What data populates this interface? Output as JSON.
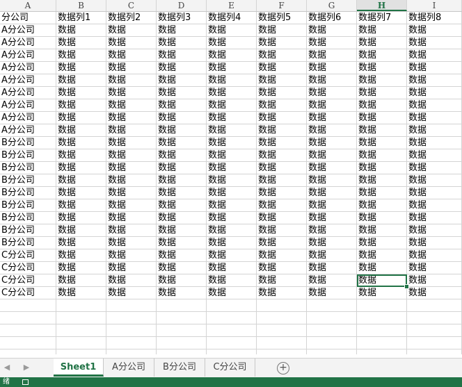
{
  "columns": [
    "A",
    "B",
    "C",
    "D",
    "E",
    "F",
    "G",
    "H",
    "I"
  ],
  "active_column": "H",
  "header_row": [
    "分公司",
    "数据列1",
    "数据列2",
    "数据列3",
    "数据列4",
    "数据列5",
    "数据列6",
    "数据列7",
    "数据列8"
  ],
  "rows": [
    [
      "A分公司",
      "数据",
      "数据",
      "数据",
      "数据",
      "数据",
      "数据",
      "数据",
      "数据"
    ],
    [
      "A分公司",
      "数据",
      "数据",
      "数据",
      "数据",
      "数据",
      "数据",
      "数据",
      "数据"
    ],
    [
      "A分公司",
      "数据",
      "数据",
      "数据",
      "数据",
      "数据",
      "数据",
      "数据",
      "数据"
    ],
    [
      "A分公司",
      "数据",
      "数据",
      "数据",
      "数据",
      "数据",
      "数据",
      "数据",
      "数据"
    ],
    [
      "A分公司",
      "数据",
      "数据",
      "数据",
      "数据",
      "数据",
      "数据",
      "数据",
      "数据"
    ],
    [
      "A分公司",
      "数据",
      "数据",
      "数据",
      "数据",
      "数据",
      "数据",
      "数据",
      "数据"
    ],
    [
      "A分公司",
      "数据",
      "数据",
      "数据",
      "数据",
      "数据",
      "数据",
      "数据",
      "数据"
    ],
    [
      "A分公司",
      "数据",
      "数据",
      "数据",
      "数据",
      "数据",
      "数据",
      "数据",
      "数据"
    ],
    [
      "A分公司",
      "数据",
      "数据",
      "数据",
      "数据",
      "数据",
      "数据",
      "数据",
      "数据"
    ],
    [
      "B分公司",
      "数据",
      "数据",
      "数据",
      "数据",
      "数据",
      "数据",
      "数据",
      "数据"
    ],
    [
      "B分公司",
      "数据",
      "数据",
      "数据",
      "数据",
      "数据",
      "数据",
      "数据",
      "数据"
    ],
    [
      "B分公司",
      "数据",
      "数据",
      "数据",
      "数据",
      "数据",
      "数据",
      "数据",
      "数据"
    ],
    [
      "B分公司",
      "数据",
      "数据",
      "数据",
      "数据",
      "数据",
      "数据",
      "数据",
      "数据"
    ],
    [
      "B分公司",
      "数据",
      "数据",
      "数据",
      "数据",
      "数据",
      "数据",
      "数据",
      "数据"
    ],
    [
      "B分公司",
      "数据",
      "数据",
      "数据",
      "数据",
      "数据",
      "数据",
      "数据",
      "数据"
    ],
    [
      "B分公司",
      "数据",
      "数据",
      "数据",
      "数据",
      "数据",
      "数据",
      "数据",
      "数据"
    ],
    [
      "B分公司",
      "数据",
      "数据",
      "数据",
      "数据",
      "数据",
      "数据",
      "数据",
      "数据"
    ],
    [
      "B分公司",
      "数据",
      "数据",
      "数据",
      "数据",
      "数据",
      "数据",
      "数据",
      "数据"
    ],
    [
      "C分公司",
      "数据",
      "数据",
      "数据",
      "数据",
      "数据",
      "数据",
      "数据",
      "数据"
    ],
    [
      "C分公司",
      "数据",
      "数据",
      "数据",
      "数据",
      "数据",
      "数据",
      "数据",
      "数据"
    ],
    [
      "C分公司",
      "数据",
      "数据",
      "数据",
      "数据",
      "数据",
      "数据",
      "数据",
      "数据"
    ],
    [
      "C分公司",
      "数据",
      "数据",
      "数据",
      "数据",
      "数据",
      "数据",
      "数据",
      "数据"
    ]
  ],
  "selected_cell": {
    "row": 20,
    "col": 7
  },
  "sheet_tabs": [
    "Sheet1",
    "A分公司",
    "B分公司",
    "C分公司"
  ],
  "active_tab": "Sheet1",
  "status": {
    "left_text": "绪"
  },
  "colors": {
    "accent": "#217346",
    "gridline": "#d4d4d4",
    "header_bg": "#f3f3f3"
  }
}
